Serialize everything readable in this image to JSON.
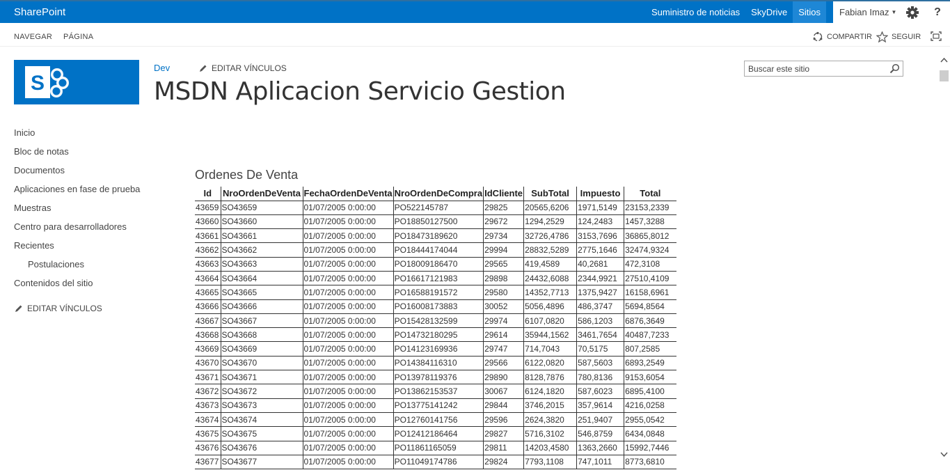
{
  "suite_bar": {
    "brand": "SharePoint",
    "links": [
      "Suministro de noticias",
      "SkyDrive",
      "Sitios"
    ],
    "active_link": "Sitios",
    "user": "Fabian Imaz",
    "help": "?"
  },
  "ribbon": {
    "tabs": [
      "NAVEGAR",
      "PÁGINA"
    ],
    "share_label": "COMPARTIR",
    "follow_label": "SEGUIR"
  },
  "site": {
    "breadcrumb": "Dev",
    "edit_links": "EDITAR VÍNCULOS",
    "title": "MSDN Aplicacion Servicio Gestion",
    "search_placeholder": "Buscar este sitio"
  },
  "quick_launch": {
    "items": [
      {
        "label": "Inicio"
      },
      {
        "label": "Bloc de notas"
      },
      {
        "label": "Documentos"
      },
      {
        "label": "Aplicaciones en fase de prueba"
      },
      {
        "label": "Muestras"
      },
      {
        "label": "Centro para desarrolladores"
      },
      {
        "label": "Recientes"
      },
      {
        "label": "Postulaciones"
      },
      {
        "label": "Contenidos del sitio"
      }
    ],
    "edit_links": "EDITAR VÍNCULOS"
  },
  "webpart": {
    "title": "Ordenes De Venta",
    "columns": [
      "Id",
      "NroOrdenDeVenta",
      "FechaOrdenDeVenta",
      "NroOrdenDeCompra",
      "IdCliente",
      "SubTotal",
      "Impuesto",
      "Total"
    ],
    "rows": [
      [
        "43659",
        "SO43659",
        "01/07/2005 0:00:00",
        "PO522145787",
        "29825",
        "20565,6206",
        "1971,5149",
        "23153,2339"
      ],
      [
        "43660",
        "SO43660",
        "01/07/2005 0:00:00",
        "PO18850127500",
        "29672",
        "1294,2529",
        "124,2483",
        "1457,3288"
      ],
      [
        "43661",
        "SO43661",
        "01/07/2005 0:00:00",
        "PO18473189620",
        "29734",
        "32726,4786",
        "3153,7696",
        "36865,8012"
      ],
      [
        "43662",
        "SO43662",
        "01/07/2005 0:00:00",
        "PO18444174044",
        "29994",
        "28832,5289",
        "2775,1646",
        "32474,9324"
      ],
      [
        "43663",
        "SO43663",
        "01/07/2005 0:00:00",
        "PO18009186470",
        "29565",
        "419,4589",
        "40,2681",
        "472,3108"
      ],
      [
        "43664",
        "SO43664",
        "01/07/2005 0:00:00",
        "PO16617121983",
        "29898",
        "24432,6088",
        "2344,9921",
        "27510,4109"
      ],
      [
        "43665",
        "SO43665",
        "01/07/2005 0:00:00",
        "PO16588191572",
        "29580",
        "14352,7713",
        "1375,9427",
        "16158,6961"
      ],
      [
        "43666",
        "SO43666",
        "01/07/2005 0:00:00",
        "PO16008173883",
        "30052",
        "5056,4896",
        "486,3747",
        "5694,8564"
      ],
      [
        "43667",
        "SO43667",
        "01/07/2005 0:00:00",
        "PO15428132599",
        "29974",
        "6107,0820",
        "586,1203",
        "6876,3649"
      ],
      [
        "43668",
        "SO43668",
        "01/07/2005 0:00:00",
        "PO14732180295",
        "29614",
        "35944,1562",
        "3461,7654",
        "40487,7233"
      ],
      [
        "43669",
        "SO43669",
        "01/07/2005 0:00:00",
        "PO14123169936",
        "29747",
        "714,7043",
        "70,5175",
        "807,2585"
      ],
      [
        "43670",
        "SO43670",
        "01/07/2005 0:00:00",
        "PO14384116310",
        "29566",
        "6122,0820",
        "587,5603",
        "6893,2549"
      ],
      [
        "43671",
        "SO43671",
        "01/07/2005 0:00:00",
        "PO13978119376",
        "29890",
        "8128,7876",
        "780,8136",
        "9153,6054"
      ],
      [
        "43672",
        "SO43672",
        "01/07/2005 0:00:00",
        "PO13862153537",
        "30067",
        "6124,1820",
        "587,6023",
        "6895,4100"
      ],
      [
        "43673",
        "SO43673",
        "01/07/2005 0:00:00",
        "PO13775141242",
        "29844",
        "3746,2015",
        "357,9614",
        "4216,0258"
      ],
      [
        "43674",
        "SO43674",
        "01/07/2005 0:00:00",
        "PO12760141756",
        "29596",
        "2624,3820",
        "251,9407",
        "2955,0542"
      ],
      [
        "43675",
        "SO43675",
        "01/07/2005 0:00:00",
        "PO12412186464",
        "29827",
        "5716,3102",
        "546,8759",
        "6434,0848"
      ],
      [
        "43676",
        "SO43676",
        "01/07/2005 0:00:00",
        "PO11861165059",
        "29811",
        "14203,4580",
        "1363,2660",
        "15992,7446"
      ],
      [
        "43677",
        "SO43677",
        "01/07/2005 0:00:00",
        "PO11049174786",
        "29824",
        "7793,1108",
        "747,1011",
        "8773,6810"
      ]
    ]
  },
  "colors": {
    "suite_bar": "#0072c6",
    "active_tab": "#1e87d6",
    "link": "#0072c6",
    "text": "#444444"
  }
}
